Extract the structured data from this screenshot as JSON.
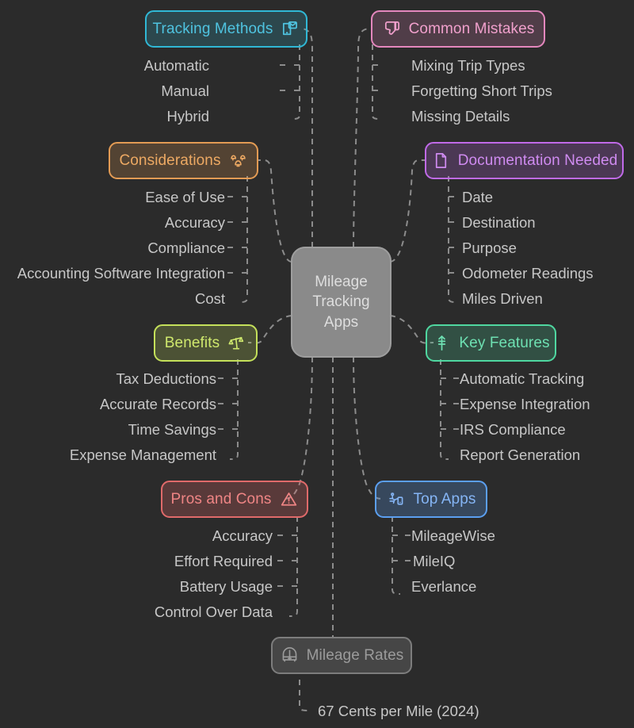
{
  "diagram": {
    "type": "mind-map",
    "background_color": "#2b2b2b",
    "center": {
      "label": "Mileage Tracking Apps",
      "line1": "Mileage",
      "line2": "Tracking",
      "line3": "Apps",
      "fill": "#8a8a8a",
      "text_color": "#dedede"
    },
    "branches": [
      {
        "id": "tracking-methods",
        "label": "Tracking Methods",
        "icon": "mail-device-icon",
        "color": "#30b8d6",
        "text_color": "#4fc3e0",
        "side": "left",
        "children": [
          "Automatic",
          "Manual",
          "Hybrid"
        ]
      },
      {
        "id": "common-mistakes",
        "label": "Common Mistakes",
        "icon": "thumbs-down-icon",
        "color": "#e487bd",
        "text_color": "#f0a0cc",
        "side": "right",
        "children": [
          "Mixing Trip Types",
          "Forgetting Short Trips",
          "Missing Details"
        ]
      },
      {
        "id": "considerations",
        "label": "Considerations",
        "icon": "alarm-bells-icon",
        "color": "#e39b54",
        "text_color": "#eda963",
        "side": "left",
        "children": [
          "Ease of Use",
          "Accuracy",
          "Compliance",
          "Accounting Software Integration",
          "Cost"
        ]
      },
      {
        "id": "documentation-needed",
        "label": "Documentation Needed",
        "icon": "document-page-icon",
        "color": "#c06ae8",
        "text_color": "#cf8bf0",
        "side": "right",
        "children": [
          "Date",
          "Destination",
          "Purpose",
          "Odometer Readings",
          "Miles Driven"
        ]
      },
      {
        "id": "benefits",
        "label": "Benefits",
        "icon": "scales-balance-icon",
        "color": "#c4e05a",
        "text_color": "#cfe86d",
        "side": "left",
        "children": [
          "Tax Deductions",
          "Accurate Records",
          "Time Savings",
          "Expense Management"
        ]
      },
      {
        "id": "key-features",
        "label": "Key Features",
        "icon": "arrow-anchor-icon",
        "color": "#4fd7a0",
        "text_color": "#6ee0b2",
        "side": "right",
        "children": [
          "Automatic Tracking",
          "Expense Integration",
          "IRS Compliance",
          "Report Generation"
        ]
      },
      {
        "id": "pros-and-cons",
        "label": "Pros and Cons",
        "icon": "warning-triangle-icon",
        "color": "#e06a6a",
        "text_color": "#ef8585",
        "side": "left",
        "children": [
          "Accuracy",
          "Effort Required",
          "Battery Usage",
          "Control Over Data"
        ]
      },
      {
        "id": "top-apps",
        "label": "Top Apps",
        "icon": "mobile-app-icon",
        "color": "#5b9ff0",
        "text_color": "#85b5f5",
        "side": "right",
        "children": [
          "MileageWise",
          "MileIQ",
          "Everlance"
        ]
      },
      {
        "id": "mileage-rates",
        "label": "Mileage Rates",
        "icon": "briefcase-icon",
        "color": "#8a8a8a",
        "text_color": "#9b9b9b",
        "side": "bottom",
        "children": [
          "67 Cents per Mile (2024)"
        ]
      }
    ]
  }
}
